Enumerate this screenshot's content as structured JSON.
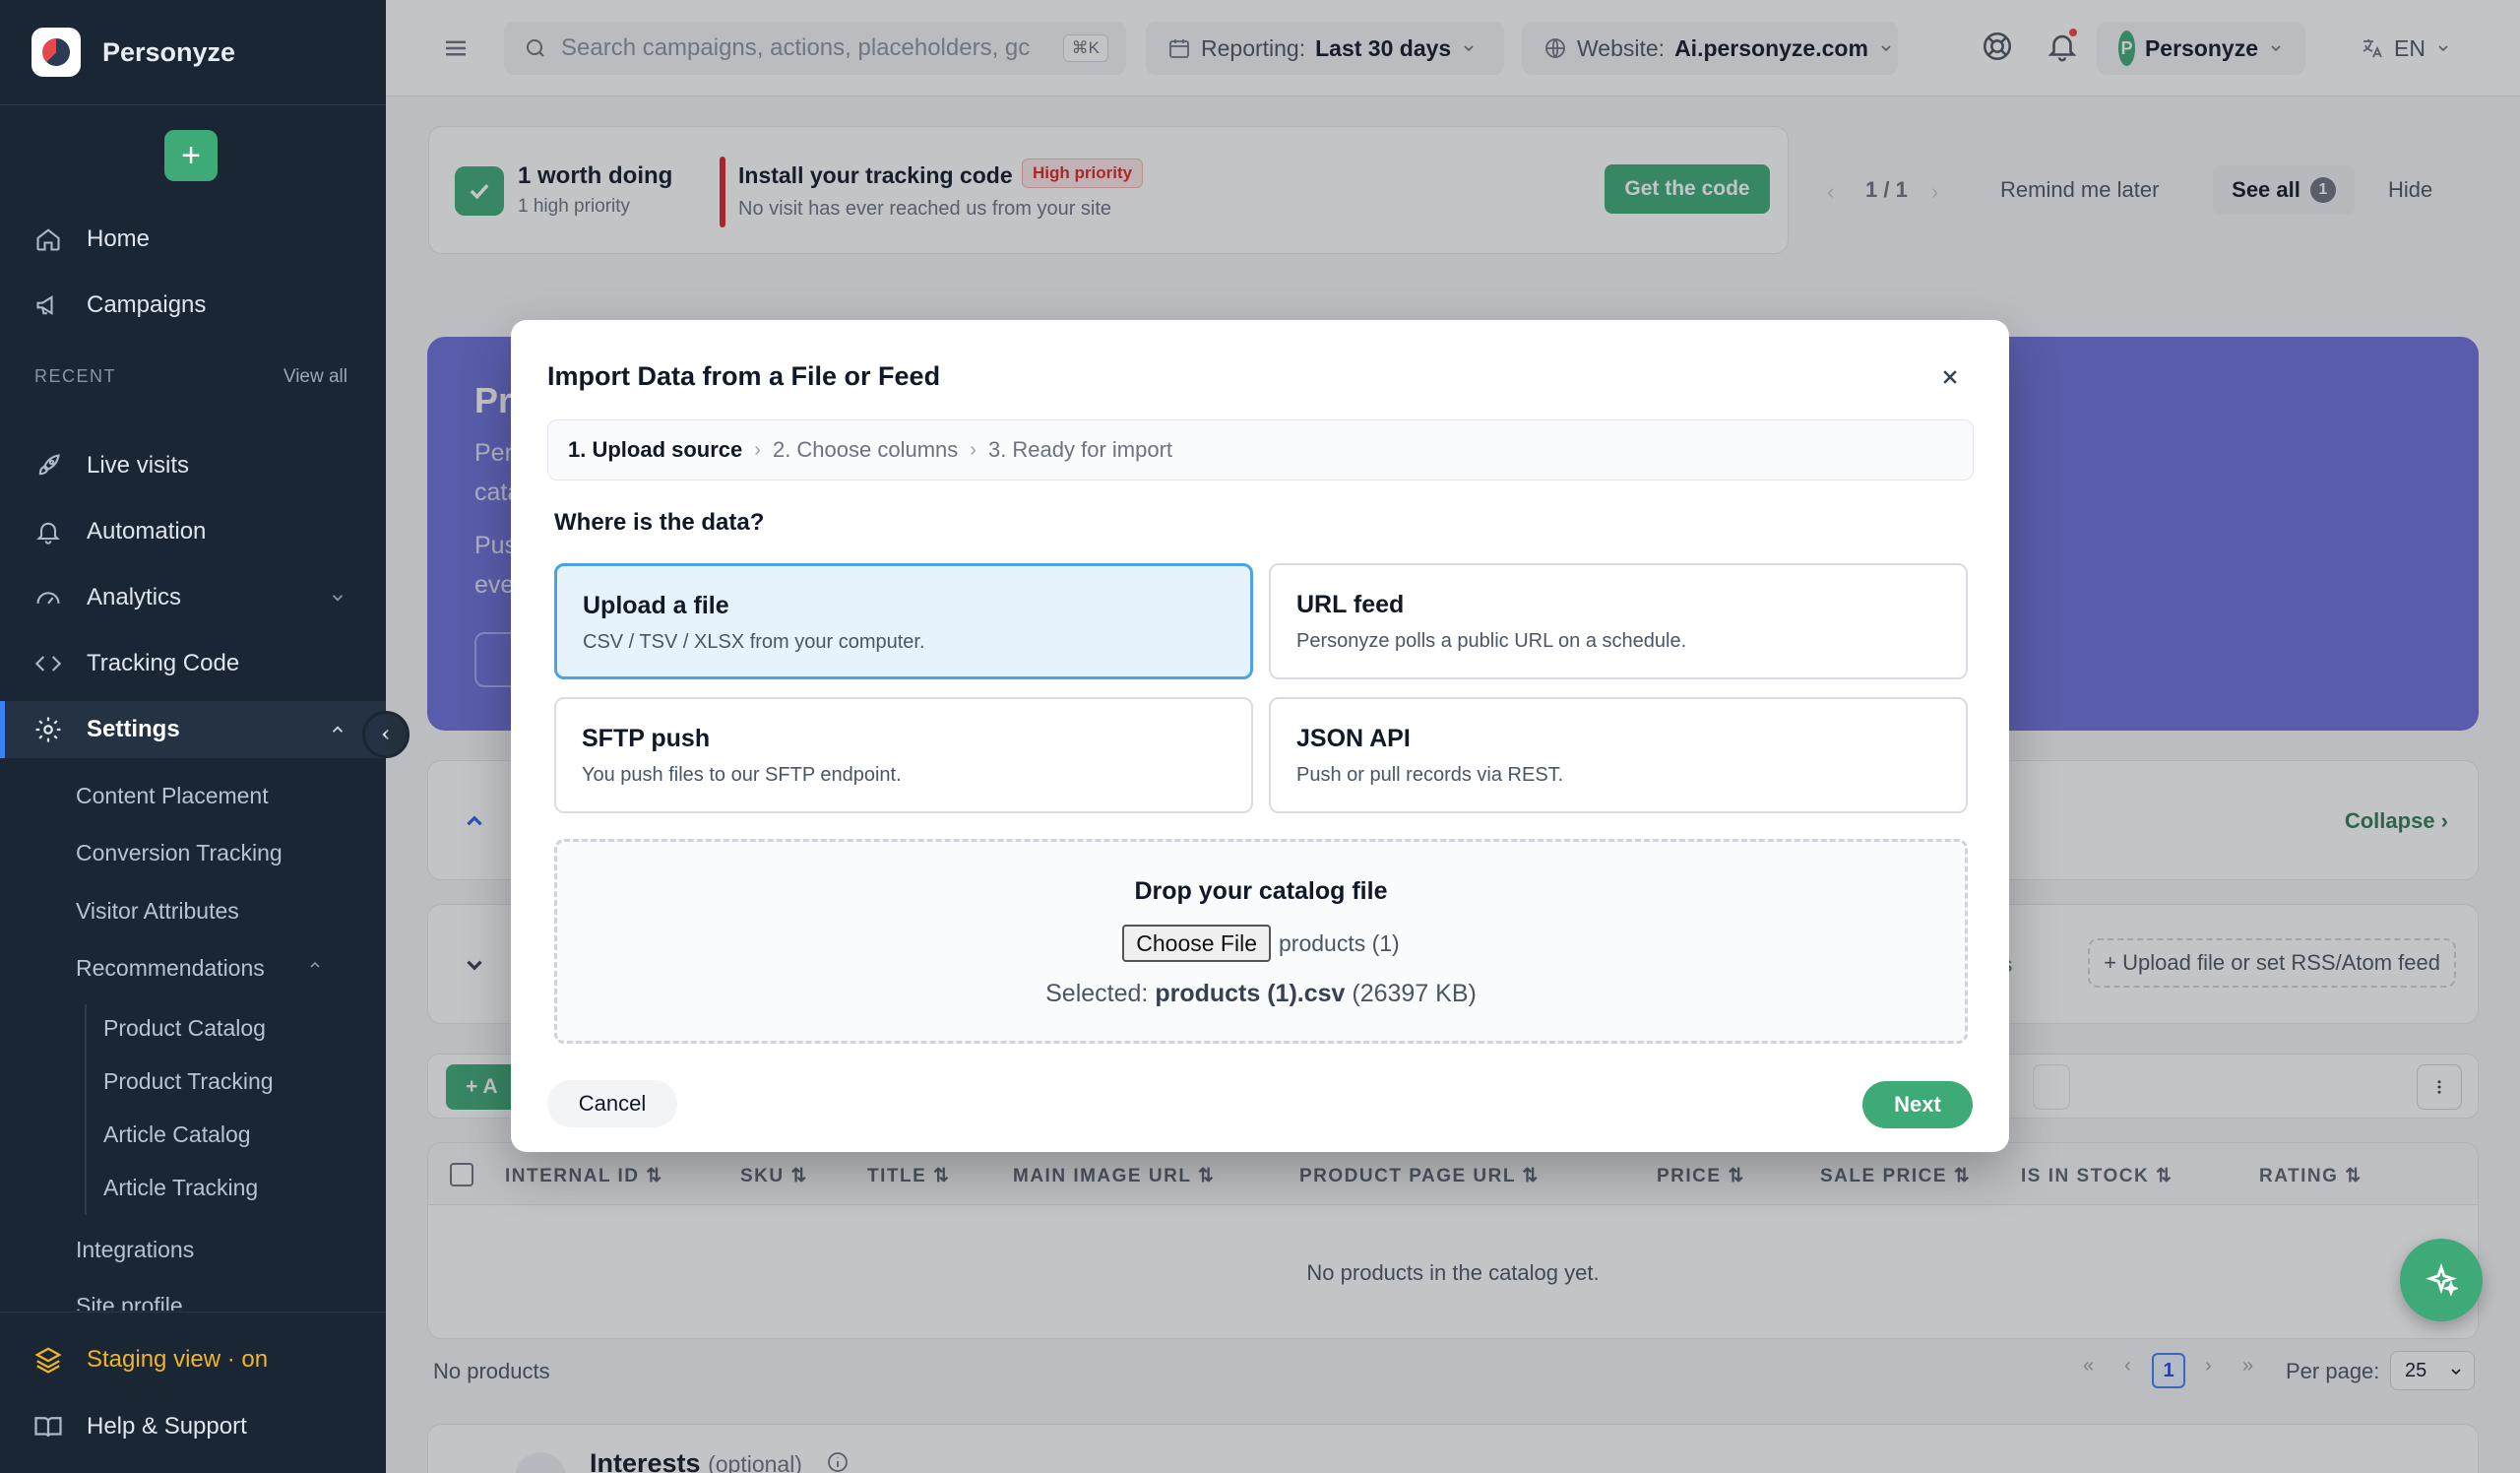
{
  "brand": {
    "name": "Personyze"
  },
  "sidebar": {
    "add_label": "+",
    "nav_top": [
      {
        "label": "Home"
      },
      {
        "label": "Campaigns"
      }
    ],
    "recent_label": "RECENT",
    "view_all": "View all",
    "nav": [
      {
        "label": "Live visits"
      },
      {
        "label": "Automation"
      },
      {
        "label": "Analytics"
      },
      {
        "label": "Tracking Code"
      },
      {
        "label": "Settings"
      }
    ],
    "settings_sub": [
      {
        "label": "Content Placement"
      },
      {
        "label": "Conversion Tracking"
      },
      {
        "label": "Visitor Attributes"
      },
      {
        "label": "Recommendations"
      }
    ],
    "recommendations_sub": [
      {
        "label": "Product Catalog"
      },
      {
        "label": "Product Tracking"
      },
      {
        "label": "Article Catalog"
      },
      {
        "label": "Article Tracking"
      }
    ],
    "settings_sub2": [
      {
        "label": "Integrations"
      },
      {
        "label": "Site profile"
      }
    ],
    "staging": "Staging view · on",
    "help": "Help & Support",
    "staging_color": "#f0b429"
  },
  "topbar": {
    "search_placeholder": "Search campaigns, actions, placeholders, gc",
    "search_shortcut": "⌘K",
    "reporting_label": "Reporting:",
    "reporting_value": "Last 30 days",
    "website_label": "Website:",
    "website_value": "Ai.personyze.com",
    "avatar_initial": "P",
    "account_name": "Personyze",
    "language": "EN"
  },
  "banner": {
    "count_title": "1 worth doing",
    "count_sub": "1 high priority",
    "task_title": "Install your tracking code",
    "priority_badge": "High priority",
    "task_sub": "No visit has ever reached us from your site",
    "cta": "Get the code",
    "pager": "1 / 1",
    "remind": "Remind me later",
    "see_all": "See all",
    "see_all_count": "1",
    "hide": "Hide"
  },
  "promo": {
    "title": "Pr",
    "line1": "Per",
    "line2": "cata",
    "line3": "Pus",
    "line4": "eve"
  },
  "sections": {
    "collapse": "Collapse ›",
    "settings_fragment": "gs",
    "upload_feed": "+ Upload file or set RSS/Atom feed",
    "add_fragment": "+ A"
  },
  "table": {
    "columns": [
      "INTERNAL ID",
      "SKU",
      "TITLE",
      "MAIN IMAGE URL",
      "PRODUCT PAGE URL",
      "PRICE",
      "SALE PRICE",
      "IS IN STOCK",
      "RATING"
    ],
    "empty": "No products in the catalog yet.",
    "footer_count": "No products",
    "current_page": "1",
    "per_page_label": "Per page:",
    "per_page_value": "25"
  },
  "interests": {
    "title": "Interests",
    "optional": "(optional)"
  },
  "modal": {
    "title": "Import Data from a File or Feed",
    "steps": [
      "1. Upload source",
      "2. Choose columns",
      "3. Ready for import"
    ],
    "question": "Where is the data?",
    "options": [
      {
        "title": "Upload a file",
        "desc": "CSV / TSV / XLSX from your computer.",
        "selected": true
      },
      {
        "title": "URL feed",
        "desc": "Personyze polls a public URL on a schedule.",
        "selected": false
      },
      {
        "title": "SFTP push",
        "desc": "You push files to our SFTP endpoint.",
        "selected": false
      },
      {
        "title": "JSON API",
        "desc": "Push or pull records via REST.",
        "selected": false
      }
    ],
    "drop_title": "Drop your catalog file",
    "choose_file": "Choose File",
    "chosen_name": "products (1)",
    "selected_prefix": "Selected:",
    "selected_file": "products (1).csv",
    "selected_size": "(26397 KB)",
    "cancel": "Cancel",
    "next": "Next"
  },
  "colors": {
    "accent_green": "#3daa78",
    "sidebar_bg": "#1b2635",
    "promo": "#6c6fd8",
    "selected_option": "#e6f2fc",
    "priority_red": "#dc2626"
  }
}
